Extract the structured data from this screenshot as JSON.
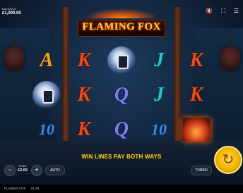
{
  "balance": {
    "label": "BALANCE",
    "value": "£1,000.00"
  },
  "top_icons": {
    "mute": "🔇",
    "fullscreen": "⛶",
    "menu": "☰"
  },
  "logo": {
    "title": "FLAMING FOX"
  },
  "reels": [
    [
      "A",
      "wild",
      "10"
    ],
    [
      "K",
      "K",
      "K"
    ],
    [
      "wild",
      "Q",
      "Q"
    ],
    [
      "J",
      "J",
      "10"
    ],
    [
      "K",
      "K",
      "chest"
    ]
  ],
  "win_lines_text": "WIN LINES PAY BOTH WAYS",
  "bet": {
    "label": "STAKE",
    "value": "£2.00",
    "minus": "−",
    "plus": "+"
  },
  "buttons": {
    "auto": "AUTO",
    "turbo": "TURBO",
    "spin_icon": "↻"
  },
  "footer": {
    "game_name": "FLAMING FOX",
    "time": "21:26"
  },
  "colors": {
    "accent_gold": "#ffd21c",
    "spin": "#f4b300"
  }
}
